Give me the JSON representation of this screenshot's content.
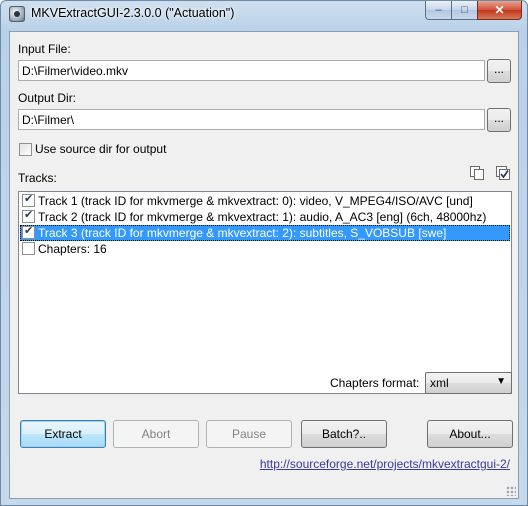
{
  "window": {
    "title": "MKVExtractGUI-2.3.0.0 (\"Actuation\")",
    "caption_buttons": {
      "minimize": "–",
      "maximize": "□",
      "close": "✕"
    }
  },
  "input_file": {
    "label": "Input File:",
    "value": "D:\\Filmer\\video.mkv",
    "browse_label": "..."
  },
  "output_dir": {
    "label": "Output Dir:",
    "value": "D:\\Filmer\\",
    "browse_label": "..."
  },
  "use_source_dir": {
    "label": "Use source dir for output",
    "checked": false
  },
  "tracks": {
    "label": "Tracks:",
    "items": [
      {
        "label": "Track 1 (track ID for mkvmerge & mkvextract: 0): video, V_MPEG4/ISO/AVC [und]",
        "checked": true,
        "selected": false
      },
      {
        "label": "Track 2 (track ID for mkvmerge & mkvextract: 1): audio, A_AC3 [eng]  (6ch, 48000hz)",
        "checked": true,
        "selected": false
      },
      {
        "label": "Track 3 (track ID for mkvmerge & mkvextract: 2): subtitles, S_VOBSUB [swe]",
        "checked": true,
        "selected": true
      },
      {
        "label": "Chapters: 16",
        "checked": false,
        "selected": false
      }
    ]
  },
  "chapters_format": {
    "label": "Chapters format:",
    "value": "xml"
  },
  "buttons": {
    "extract": "Extract",
    "abort": "Abort",
    "pause": "Pause",
    "batch": "Batch?..",
    "about": "About..."
  },
  "link": "http://sourceforge.net/projects/mkvextractgui-2/",
  "icons": [
    "app-icon",
    "copy-icon",
    "check-all-icon",
    "dropdown-arrow-icon",
    "resize-grip-icon"
  ]
}
